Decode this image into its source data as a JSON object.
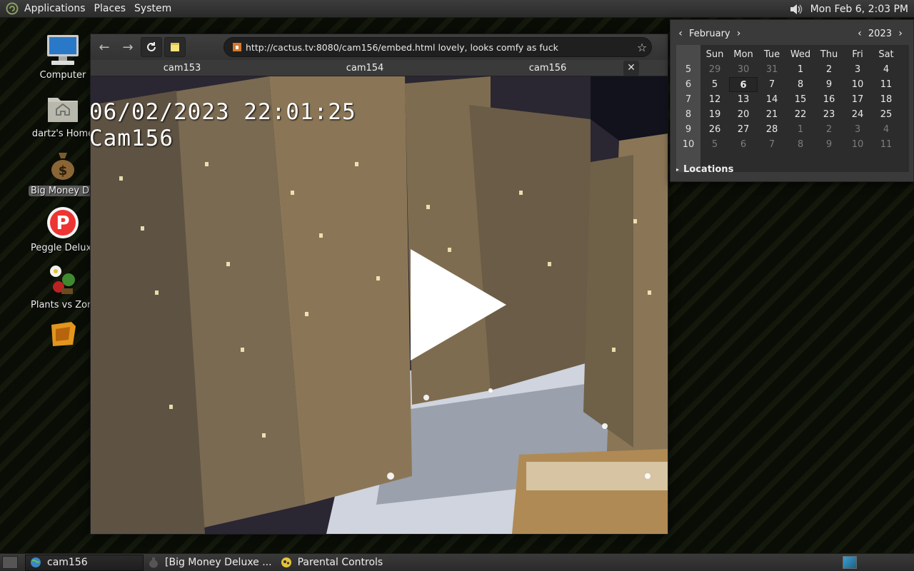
{
  "top_panel": {
    "menus": [
      "Applications",
      "Places",
      "System"
    ],
    "clock": "Mon Feb  6,  2:03 PM"
  },
  "desktop_icons": [
    {
      "label": "Computer",
      "icon": "computer-icon"
    },
    {
      "label": "dartz's Home",
      "icon": "home-folder-icon"
    },
    {
      "label": "Big Money Deluxe",
      "icon": "money-bag-icon",
      "selected": true
    },
    {
      "label": "Peggle Deluxe",
      "icon": "peggle-icon"
    },
    {
      "label": "Plants vs Zombies",
      "icon": "plants-vs-zombies-icon"
    },
    {
      "label": "",
      "icon": "game-box-icon"
    }
  ],
  "browser": {
    "url": "http://cactus.tv:8080/cam156/embed.html lovely, looks comfy as fuck",
    "tabs": [
      "cam153",
      "cam154",
      "cam156"
    ],
    "close_label": "✕",
    "video": {
      "timestamp": "06/02/2023 22:01:25",
      "camera": "Cam156"
    }
  },
  "calendar": {
    "month": "February",
    "year": "2023",
    "weekdays": [
      "Sun",
      "Mon",
      "Tue",
      "Wed",
      "Thu",
      "Fri",
      "Sat"
    ],
    "weeks": [
      {
        "num": "5",
        "days": [
          "29",
          "30",
          "31",
          "1",
          "2",
          "3",
          "4"
        ]
      },
      {
        "num": "6",
        "days": [
          "5",
          "6",
          "7",
          "8",
          "9",
          "10",
          "11"
        ]
      },
      {
        "num": "7",
        "days": [
          "12",
          "13",
          "14",
          "15",
          "16",
          "17",
          "18"
        ]
      },
      {
        "num": "8",
        "days": [
          "19",
          "20",
          "21",
          "22",
          "23",
          "24",
          "25"
        ]
      },
      {
        "num": "9",
        "days": [
          "26",
          "27",
          "28",
          "1",
          "2",
          "3",
          "4"
        ]
      },
      {
        "num": "10",
        "days": [
          "5",
          "6",
          "7",
          "8",
          "9",
          "10",
          "11"
        ]
      }
    ],
    "today": "6",
    "locations_label": "Locations"
  },
  "taskbar": {
    "tasks": [
      {
        "label": "cam156",
        "icon": "globe-icon",
        "active": true
      },
      {
        "label": "[Big Money Deluxe ...",
        "icon": "money-bag-icon",
        "active": false
      },
      {
        "label": "Parental Controls",
        "icon": "parental-controls-icon",
        "active": false
      }
    ]
  }
}
